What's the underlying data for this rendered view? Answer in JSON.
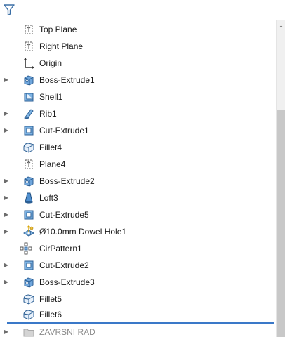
{
  "toolbar": {
    "filter_icon": "funnel-filter-icon"
  },
  "tree": {
    "items": [
      {
        "label": "Top Plane",
        "icon": "plane-icon",
        "expandable": false
      },
      {
        "label": "Right Plane",
        "icon": "plane-icon",
        "expandable": false
      },
      {
        "label": "Origin",
        "icon": "origin-icon",
        "expandable": false
      },
      {
        "label": "Boss-Extrude1",
        "icon": "boss-extrude-icon",
        "expandable": true
      },
      {
        "label": "Shell1",
        "icon": "shell-icon",
        "expandable": false
      },
      {
        "label": "Rib1",
        "icon": "rib-icon",
        "expandable": true
      },
      {
        "label": "Cut-Extrude1",
        "icon": "cut-extrude-icon",
        "expandable": true
      },
      {
        "label": "Fillet4",
        "icon": "fillet-icon",
        "expandable": false
      },
      {
        "label": "Plane4",
        "icon": "plane-icon",
        "expandable": false
      },
      {
        "label": "Boss-Extrude2",
        "icon": "boss-extrude-icon",
        "expandable": true
      },
      {
        "label": "Loft3",
        "icon": "loft-icon",
        "expandable": true
      },
      {
        "label": "Cut-Extrude5",
        "icon": "cut-extrude-icon",
        "expandable": true
      },
      {
        "label": "Ø10.0mm Dowel Hole1",
        "icon": "hole-wizard-icon",
        "expandable": true
      },
      {
        "label": "CirPattern1",
        "icon": "circular-pattern-icon",
        "expandable": false
      },
      {
        "label": "Cut-Extrude2",
        "icon": "cut-extrude-icon",
        "expandable": true
      },
      {
        "label": "Boss-Extrude3",
        "icon": "boss-extrude-icon",
        "expandable": true
      },
      {
        "label": "Fillet5",
        "icon": "fillet-icon",
        "expandable": false
      },
      {
        "label": "Fillet6",
        "icon": "fillet-icon",
        "expandable": false
      },
      {
        "label": "ZAVRSNI RAD",
        "icon": "folder-icon",
        "expandable": true,
        "suppressed": true
      }
    ]
  },
  "colors": {
    "rollback_bar": "#3a78c8",
    "accent_blue": "#2f6fb8",
    "folder_gray": "#c9c9c9"
  }
}
